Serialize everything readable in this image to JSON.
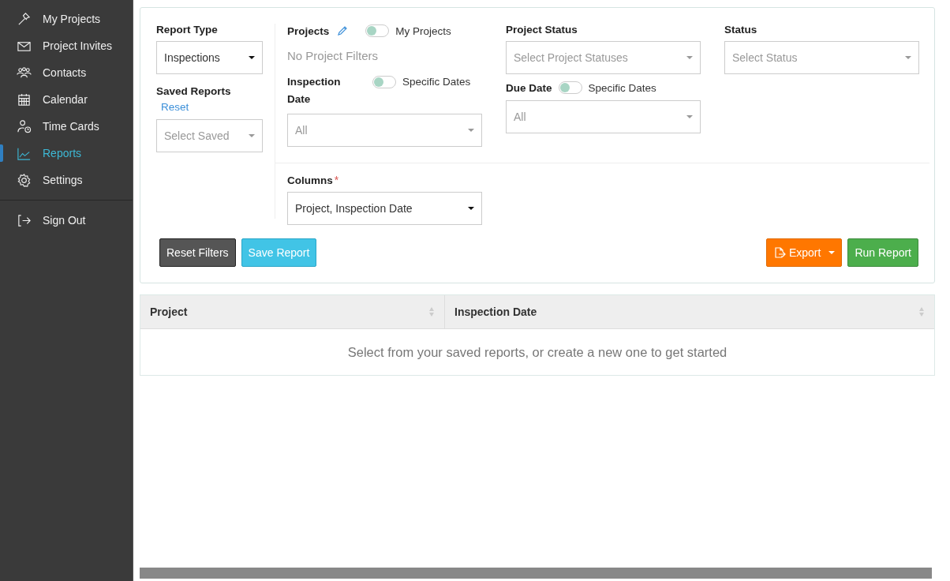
{
  "sidebar": {
    "items": [
      {
        "label": "My Projects",
        "selected": false
      },
      {
        "label": "Project Invites",
        "selected": false
      },
      {
        "label": "Contacts",
        "selected": false
      },
      {
        "label": "Calendar",
        "selected": false
      },
      {
        "label": "Time Cards",
        "selected": false
      },
      {
        "label": "Reports",
        "selected": true
      },
      {
        "label": "Settings",
        "selected": false
      }
    ],
    "footer_items": [
      {
        "label": "Sign Out",
        "selected": false
      }
    ]
  },
  "filters": {
    "report_type": {
      "label": "Report Type",
      "value": "Inspections"
    },
    "saved_reports": {
      "label": "Saved Reports",
      "reset_link": "Reset",
      "placeholder": "Select Saved"
    },
    "projects": {
      "label": "Projects",
      "toggle": {
        "label": "My Projects",
        "on": false
      },
      "summary": "No Project Filters"
    },
    "inspection_date": {
      "label": "Inspection Date",
      "toggle": {
        "label": "Specific Dates",
        "on": false
      },
      "placeholder": "All"
    },
    "project_status": {
      "label": "Project Status",
      "placeholder": "Select Project Statuses"
    },
    "due_date": {
      "label": "Due Date",
      "toggle": {
        "label": "Specific Dates",
        "on": false
      },
      "placeholder": "All"
    },
    "status": {
      "label": "Status",
      "placeholder": "Select Status"
    },
    "columns": {
      "label": "Columns",
      "required_mark": "*",
      "value": "Project, Inspection Date"
    }
  },
  "actions": {
    "reset_filters": "Reset Filters",
    "save_report": "Save Report",
    "export": "Export",
    "run_report": "Run Report"
  },
  "table": {
    "columns": [
      "Project",
      "Inspection Date"
    ],
    "empty_message": "Select from your saved reports, or create a new one to get started"
  }
}
